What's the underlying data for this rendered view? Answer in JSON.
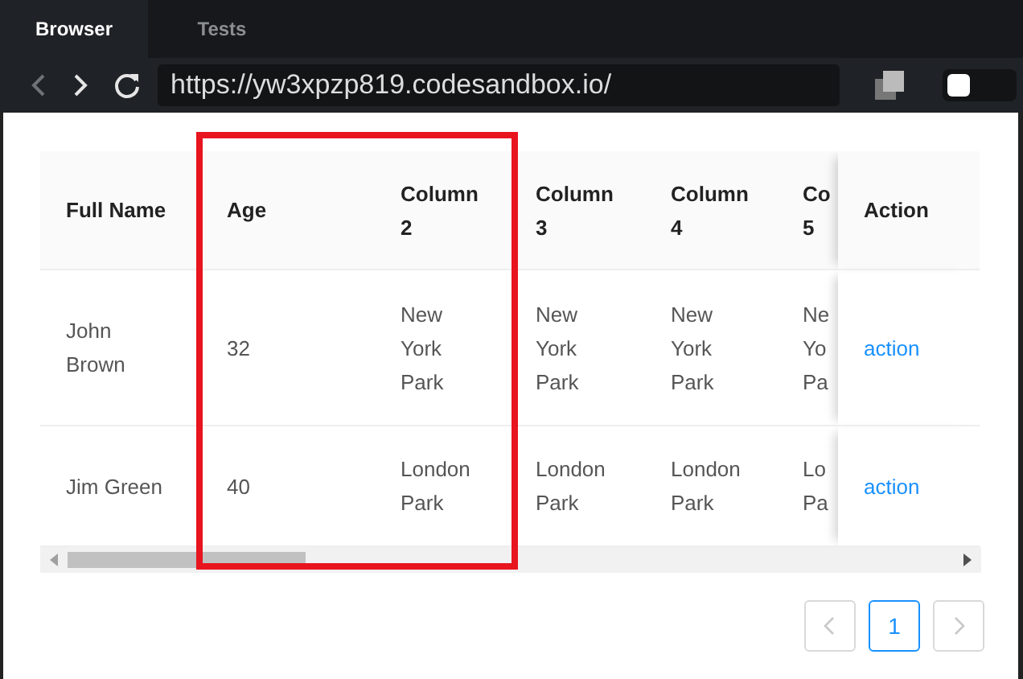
{
  "tabs": [
    {
      "label": "Browser",
      "selected": true
    },
    {
      "label": "Tests",
      "selected": false
    }
  ],
  "toolbar": {
    "back": {
      "disabled": true
    },
    "forward": {
      "disabled": false
    },
    "url": "https://yw3xpzp819.codesandbox.io/",
    "toggle": {
      "on": false
    }
  },
  "table": {
    "columns": [
      "Full Name",
      "Age",
      "Column 2",
      "Column 3",
      "Column 4",
      "Co 5",
      "Action"
    ],
    "rows": [
      {
        "cells": [
          "John Brown",
          "32",
          "New York Park",
          "New York Park",
          "New York Park",
          "Ne Yo Pa"
        ],
        "action": "action"
      },
      {
        "cells": [
          "Jim Green",
          "40",
          "London Park",
          "London Park",
          "London Park",
          "Lo Pa"
        ],
        "action": "action"
      }
    ]
  },
  "pagination": {
    "prev": {
      "disabled": true
    },
    "pages": [
      {
        "label": "1",
        "selected": true
      }
    ],
    "next": {
      "disabled": true
    }
  }
}
